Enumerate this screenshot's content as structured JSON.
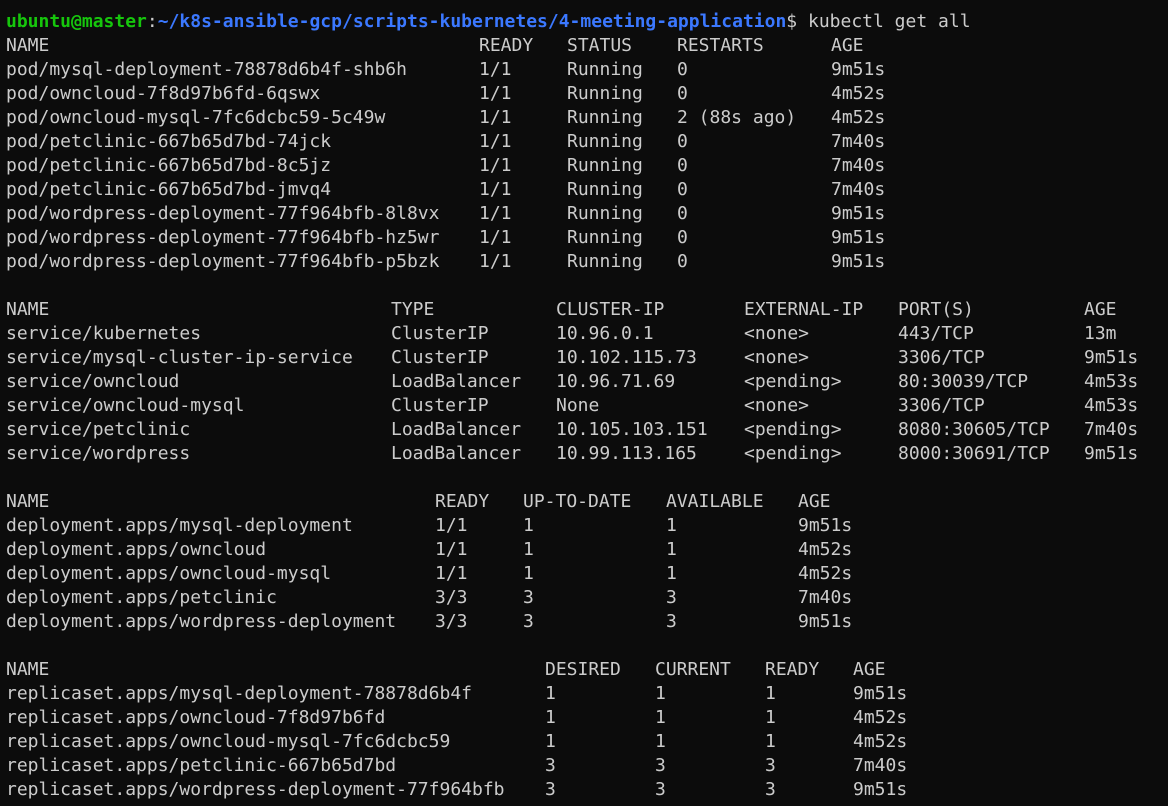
{
  "prompt": {
    "user": "ubuntu",
    "at": "@",
    "host": "master",
    "sep": ":",
    "path": "~/k8s-ansible-gcp/scripts-kubernetes/4-meeting-application",
    "dollar": "$",
    "command": "kubectl get all"
  },
  "pods": {
    "headers": [
      "NAME",
      "READY",
      "STATUS",
      "RESTARTS",
      "AGE"
    ],
    "rows": [
      [
        "pod/mysql-deployment-78878d6b4f-shb6h",
        "1/1",
        "Running",
        "0",
        "9m51s"
      ],
      [
        "pod/owncloud-7f8d97b6fd-6qswx",
        "1/1",
        "Running",
        "0",
        "4m52s"
      ],
      [
        "pod/owncloud-mysql-7fc6dcbc59-5c49w",
        "1/1",
        "Running",
        "2 (88s ago)",
        "4m52s"
      ],
      [
        "pod/petclinic-667b65d7bd-74jck",
        "1/1",
        "Running",
        "0",
        "7m40s"
      ],
      [
        "pod/petclinic-667b65d7bd-8c5jz",
        "1/1",
        "Running",
        "0",
        "7m40s"
      ],
      [
        "pod/petclinic-667b65d7bd-jmvq4",
        "1/1",
        "Running",
        "0",
        "7m40s"
      ],
      [
        "pod/wordpress-deployment-77f964bfb-8l8vx",
        "1/1",
        "Running",
        "0",
        "9m51s"
      ],
      [
        "pod/wordpress-deployment-77f964bfb-hz5wr",
        "1/1",
        "Running",
        "0",
        "9m51s"
      ],
      [
        "pod/wordpress-deployment-77f964bfb-p5bzk",
        "1/1",
        "Running",
        "0",
        "9m51s"
      ]
    ]
  },
  "services": {
    "headers": [
      "NAME",
      "TYPE",
      "CLUSTER-IP",
      "EXTERNAL-IP",
      "PORT(S)",
      "AGE"
    ],
    "rows": [
      [
        "service/kubernetes",
        "ClusterIP",
        "10.96.0.1",
        "<none>",
        "443/TCP",
        "13m"
      ],
      [
        "service/mysql-cluster-ip-service",
        "ClusterIP",
        "10.102.115.73",
        "<none>",
        "3306/TCP",
        "9m51s"
      ],
      [
        "service/owncloud",
        "LoadBalancer",
        "10.96.71.69",
        "<pending>",
        "80:30039/TCP",
        "4m53s"
      ],
      [
        "service/owncloud-mysql",
        "ClusterIP",
        "None",
        "<none>",
        "3306/TCP",
        "4m53s"
      ],
      [
        "service/petclinic",
        "LoadBalancer",
        "10.105.103.151",
        "<pending>",
        "8080:30605/TCP",
        "7m40s"
      ],
      [
        "service/wordpress",
        "LoadBalancer",
        "10.99.113.165",
        "<pending>",
        "8000:30691/TCP",
        "9m51s"
      ]
    ]
  },
  "deployments": {
    "headers": [
      "NAME",
      "READY",
      "UP-TO-DATE",
      "AVAILABLE",
      "AGE"
    ],
    "rows": [
      [
        "deployment.apps/mysql-deployment",
        "1/1",
        "1",
        "1",
        "9m51s"
      ],
      [
        "deployment.apps/owncloud",
        "1/1",
        "1",
        "1",
        "4m52s"
      ],
      [
        "deployment.apps/owncloud-mysql",
        "1/1",
        "1",
        "1",
        "4m52s"
      ],
      [
        "deployment.apps/petclinic",
        "3/3",
        "3",
        "3",
        "7m40s"
      ],
      [
        "deployment.apps/wordpress-deployment",
        "3/3",
        "3",
        "3",
        "9m51s"
      ]
    ]
  },
  "replicasets": {
    "headers": [
      "NAME",
      "DESIRED",
      "CURRENT",
      "READY",
      "AGE"
    ],
    "rows": [
      [
        "replicaset.apps/mysql-deployment-78878d6b4f",
        "1",
        "1",
        "1",
        "9m51s"
      ],
      [
        "replicaset.apps/owncloud-7f8d97b6fd",
        "1",
        "1",
        "1",
        "4m52s"
      ],
      [
        "replicaset.apps/owncloud-mysql-7fc6dcbc59",
        "1",
        "1",
        "1",
        "4m52s"
      ],
      [
        "replicaset.apps/petclinic-667b65d7bd",
        "3",
        "3",
        "3",
        "7m40s"
      ],
      [
        "replicaset.apps/wordpress-deployment-77f964bfb",
        "3",
        "3",
        "3",
        "9m51s"
      ]
    ]
  }
}
